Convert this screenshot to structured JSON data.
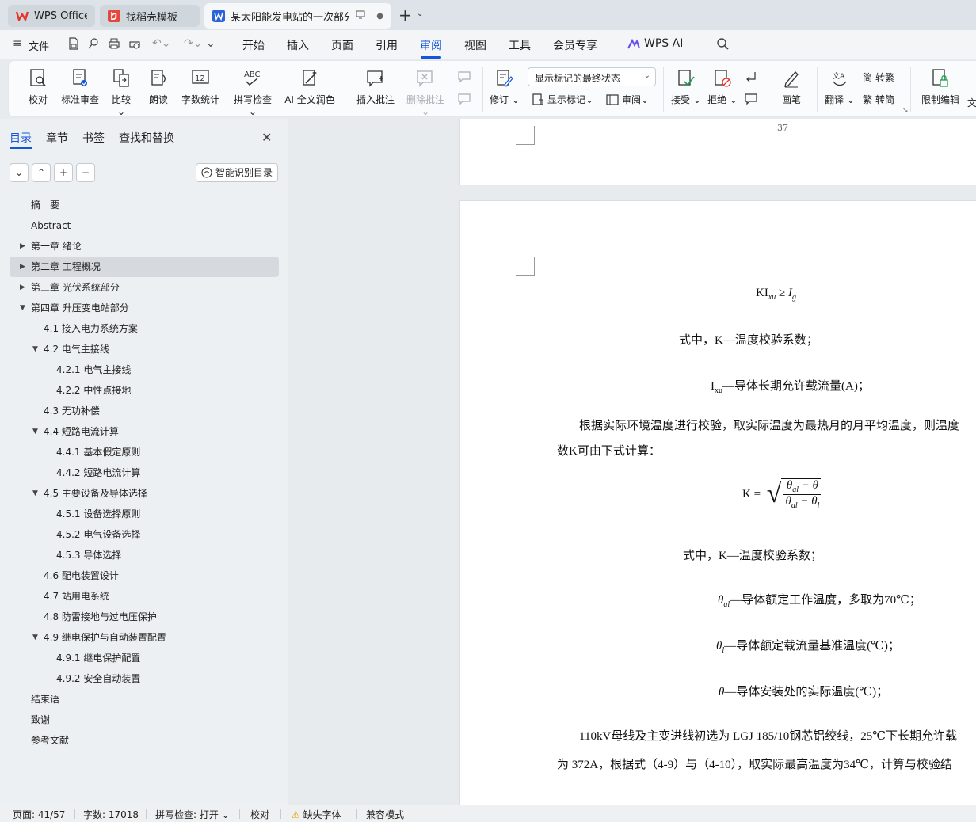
{
  "tabs": [
    {
      "label": "WPS Office"
    },
    {
      "label": "找稻壳模板"
    },
    {
      "label": "某太阳能发电站的一次部分设"
    }
  ],
  "menu": {
    "file": "文件",
    "items": [
      "开始",
      "插入",
      "页面",
      "引用",
      "审阅",
      "视图",
      "工具",
      "会员专享"
    ],
    "active": "审阅",
    "wps_ai": "WPS AI"
  },
  "ribbon": {
    "proofread": "校对",
    "standard_review": "标准审查",
    "compare": "比较",
    "read_aloud": "朗读",
    "word_count": "字数统计",
    "spell_check": "拼写检查",
    "ai_polish": "AI 全文润色",
    "insert_comment": "插入批注",
    "delete_comment": "删除批注",
    "track_changes": "修订",
    "markup_state": "显示标记的最终状态",
    "show_markup": "显示标记",
    "review_pane": "审阅",
    "accept": "接受",
    "reject": "拒绝",
    "ink": "画笔",
    "translate": "翻译",
    "to_traditional": "转繁",
    "to_simplified": "转简",
    "restrict_edit": "限制编辑",
    "word_count_icon_text": "12",
    "spell_icon_text": "ABC",
    "trad_icon_text": "简",
    "simp_icon_text": "繁",
    "translate_icon_text": "文A",
    "truncated": "文"
  },
  "nav": {
    "tabs": [
      "目录",
      "章节",
      "书签",
      "查找和替换"
    ],
    "smart_toc": "智能识别目录",
    "toc": [
      {
        "label": "摘　要",
        "level": 0,
        "arrow": ""
      },
      {
        "label": "Abstract",
        "level": 0,
        "arrow": ""
      },
      {
        "label": "第一章 绪论",
        "level": 0,
        "arrow": "▶"
      },
      {
        "label": "第二章 工程概况",
        "level": 0,
        "arrow": "▶",
        "selected": true
      },
      {
        "label": "第三章 光伏系统部分",
        "level": 0,
        "arrow": "▶"
      },
      {
        "label": "第四章 升压变电站部分",
        "level": 0,
        "arrow": "▼"
      },
      {
        "label": "4.1 接入电力系统方案",
        "level": 1,
        "arrow": ""
      },
      {
        "label": "4.2 电气主接线",
        "level": 1,
        "arrow": "▼"
      },
      {
        "label": "4.2.1 电气主接线",
        "level": 2,
        "arrow": ""
      },
      {
        "label": "4.2.2 中性点接地",
        "level": 2,
        "arrow": ""
      },
      {
        "label": "4.3 无功补偿",
        "level": 1,
        "arrow": ""
      },
      {
        "label": "4.4 短路电流计算",
        "level": 1,
        "arrow": "▼"
      },
      {
        "label": "4.4.1 基本假定原则",
        "level": 2,
        "arrow": ""
      },
      {
        "label": "4.4.2 短路电流计算",
        "level": 2,
        "arrow": ""
      },
      {
        "label": "4.5 主要设备及导体选择",
        "level": 1,
        "arrow": "▼"
      },
      {
        "label": "4.5.1 设备选择原则",
        "level": 2,
        "arrow": ""
      },
      {
        "label": "4.5.2 电气设备选择",
        "level": 2,
        "arrow": ""
      },
      {
        "label": "4.5.3 导体选择",
        "level": 2,
        "arrow": ""
      },
      {
        "label": "4.6 配电装置设计",
        "level": 1,
        "arrow": ""
      },
      {
        "label": "4.7 站用电系统",
        "level": 1,
        "arrow": ""
      },
      {
        "label": "4.8 防雷接地与过电压保护",
        "level": 1,
        "arrow": ""
      },
      {
        "label": "4.9 继电保护与自动装置配置",
        "level": 1,
        "arrow": "▼"
      },
      {
        "label": "4.9.1 继电保护配置",
        "level": 2,
        "arrow": ""
      },
      {
        "label": "4.9.2 安全自动装置",
        "level": 2,
        "arrow": ""
      },
      {
        "label": "结束语",
        "level": 0,
        "arrow": ""
      },
      {
        "label": "致谢",
        "level": 0,
        "arrow": ""
      },
      {
        "label": "参考文献",
        "level": 0,
        "arrow": ""
      }
    ]
  },
  "doc": {
    "page_number": "37",
    "eq1_main": "KI",
    "eq1_sub": "xu",
    "eq1_rel": " ≥ I",
    "eq1_sub2": "g",
    "line_where1": "式中，K—温度校验系数；",
    "ixu_main": "I",
    "ixu_sub": "xu",
    "ixu_text": "—导体长期允许载流量(A)；",
    "para1_a": "根据实际环境温度进行校验，取实际温度为最热月的月平均温度，则温度",
    "para1_b": "数K可由下式计算：",
    "eq2_left": "K =",
    "eq2_num": "θ",
    "eq2_num_sub": "al",
    "eq2_num_rest": " − θ",
    "eq2_den": "θ",
    "eq2_den_sub": "al",
    "eq2_den_rest": " − θ",
    "eq2_den_sub2": "l",
    "line_where2": "式中，K—温度校验系数；",
    "theta_al": "θ",
    "theta_al_sub": "al",
    "theta_al_text": "—导体额定工作温度，多取为70℃；",
    "theta_l": "θ",
    "theta_l_sub": "l",
    "theta_l_text": "—导体额定载流量基准温度(℃)；",
    "theta": "θ",
    "theta_text": "—导体安装处的实际温度(℃)；",
    "para2_a": "110kV母线及主变进线初选为  LGJ 185/10钢芯铝绞线，25℃下长期允许载",
    "para2_b": "为  372A，根据式（4-9）与（4-10），取实际最高温度为34℃，计算与校验结"
  },
  "status": {
    "page": "页面: 41/57",
    "words": "字数: 17018",
    "spell": "拼写检查: 打开",
    "proof": "校对",
    "missing_font": "缺失字体",
    "compat": "兼容模式"
  },
  "colors": {
    "accent": "#1556d8",
    "wps_red": "#e5362d",
    "docer_red": "#e2483c",
    "word_blue": "#2b63d9"
  }
}
